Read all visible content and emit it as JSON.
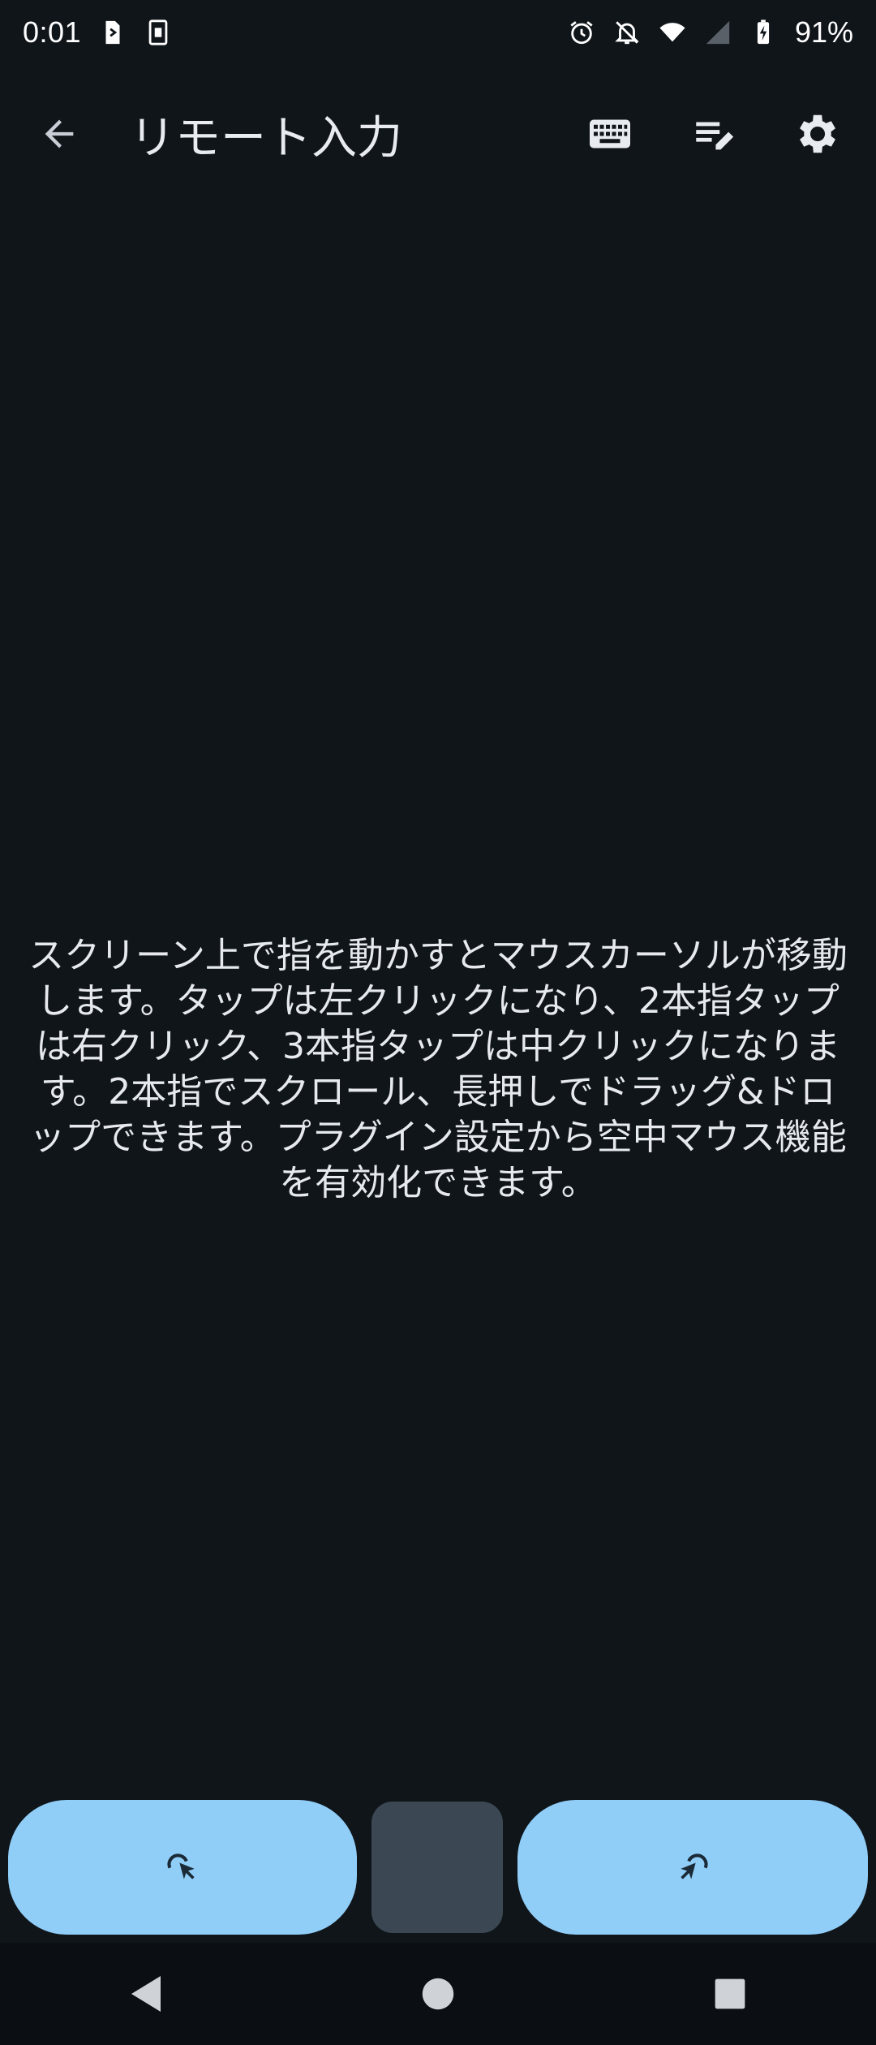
{
  "status_bar": {
    "time": "0:01",
    "battery_percent": "91%",
    "icons": [
      "sim-toolkit-icon",
      "sd-card-icon",
      "alarm-icon",
      "notifications-off-icon",
      "wifi-icon",
      "cell-signal-icon",
      "battery-charging-icon"
    ]
  },
  "app_bar": {
    "title": "リモート入力",
    "back_icon": "arrow-back-icon",
    "actions": [
      "keyboard-icon",
      "edit-list-icon",
      "settings-icon"
    ]
  },
  "touchpad": {
    "instructions": "スクリーン上で指を動かすとマウスカーソルが移動します。タップは左クリックになり、2本指タップは右クリック、3本指タップは中クリックになります。2本指でスクロール、長押しでドラッグ&ドロップできます。プラグイン設定から空中マウス機能を有効化できます。"
  },
  "mouse_buttons": {
    "left_icon": "left-click-icon",
    "middle_icon": "middle-click",
    "right_icon": "right-click-icon",
    "accent_color": "#90cef8",
    "middle_color": "#3b4853"
  },
  "nav_bar": {
    "buttons": [
      "back-triangle-icon",
      "home-circle-icon",
      "recents-square-icon"
    ]
  }
}
